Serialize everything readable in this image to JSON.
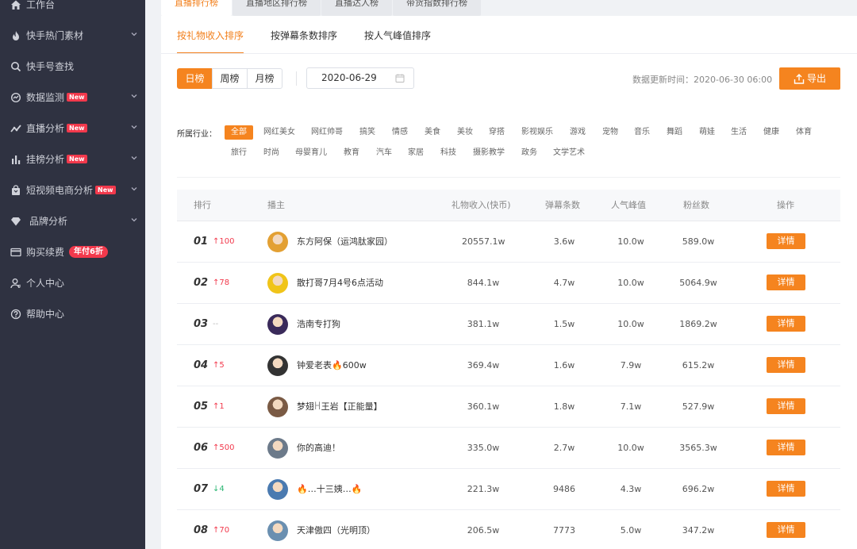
{
  "sidebar": {
    "items": [
      {
        "label": "工作台",
        "icon": "home-icon"
      },
      {
        "label": "快手热门素材",
        "icon": "fire-icon"
      },
      {
        "label": "快手号查找",
        "icon": "search-icon"
      },
      {
        "label": "数据监测",
        "icon": "monitor-icon",
        "badge": "New"
      },
      {
        "label": "直播分析",
        "icon": "trend-icon",
        "badge": "New"
      },
      {
        "label": "挂榜分析",
        "icon": "bars-icon",
        "badge": "New"
      },
      {
        "label": "短视频电商分析",
        "icon": "bag-icon",
        "badge": "New"
      },
      {
        "label": "品牌分析",
        "icon": "diamond-icon"
      },
      {
        "label": "购买续费",
        "icon": "card-icon",
        "promo": "年付6折"
      },
      {
        "label": "个人中心",
        "icon": "user-icon"
      },
      {
        "label": "帮助中心",
        "icon": "help-icon"
      }
    ]
  },
  "top_tabs": [
    "直播排行榜",
    "直播地区排行榜",
    "直播达人榜",
    "带货指数排行榜"
  ],
  "sub_tabs": [
    "按礼物收入排序",
    "按弹幕条数排序",
    "按人气峰值排序"
  ],
  "period": [
    "日榜",
    "周榜",
    "月榜"
  ],
  "date_value": "2020-06-29",
  "update_info": "数据更新时间：2020-06-30 06:00",
  "export_label": "导出",
  "industry_label": "所属行业：",
  "industries_row1": [
    "全部",
    "网红美女",
    "网红帅哥",
    "搞笑",
    "情感",
    "美食",
    "美妆",
    "穿搭",
    "影视娱乐",
    "游戏",
    "宠物",
    "音乐",
    "舞蹈",
    "萌娃",
    "生活",
    "健康",
    "体育"
  ],
  "industries_row2": [
    "旅行",
    "时尚",
    "母婴育儿",
    "教育",
    "汽车",
    "家居",
    "科技",
    "摄影教学",
    "政务",
    "文学艺术"
  ],
  "table": {
    "headers": [
      "排行",
      "播主",
      "礼物收入(快币)",
      "弹幕条数",
      "人气峰值",
      "粉丝数",
      "操作"
    ],
    "detail_label": "详情",
    "rows": [
      {
        "rank": "01",
        "change": "↑100",
        "dir": "up",
        "name": "东方阿保（运鸿肽家园）",
        "gift": "20557.1w",
        "danmu": "3.6w",
        "peak": "10.0w",
        "fans": "589.0w",
        "avatar_color": "#e3a033"
      },
      {
        "rank": "02",
        "change": "↑78",
        "dir": "up",
        "name": "散打哥7月4号6点活动",
        "gift": "844.1w",
        "danmu": "4.7w",
        "peak": "10.0w",
        "fans": "5064.9w",
        "avatar_color": "#f0c419"
      },
      {
        "rank": "03",
        "change": "--",
        "dir": "flat",
        "name": "浩南专打狗",
        "gift": "381.1w",
        "danmu": "1.5w",
        "peak": "10.0w",
        "fans": "1869.2w",
        "avatar_color": "#3a2a5a"
      },
      {
        "rank": "04",
        "change": "↑5",
        "dir": "up",
        "name": "钟爱老表🔥600w",
        "gift": "369.4w",
        "danmu": "1.6w",
        "peak": "7.9w",
        "fans": "615.2w",
        "avatar_color": "#333333"
      },
      {
        "rank": "05",
        "change": "↑1",
        "dir": "up",
        "name": "梦翅ꀿ王岩【正能量】",
        "gift": "360.1w",
        "danmu": "1.8w",
        "peak": "7.1w",
        "fans": "527.9w",
        "avatar_color": "#7a5a44"
      },
      {
        "rank": "06",
        "change": "↑500",
        "dir": "up",
        "name": "你的高迪！",
        "gift": "335.0w",
        "danmu": "2.7w",
        "peak": "10.0w",
        "fans": "3565.3w",
        "avatar_color": "#6c7a8a"
      },
      {
        "rank": "07",
        "change": "↓4",
        "dir": "down",
        "name": "🔥…十三姨…🔥",
        "gift": "221.3w",
        "danmu": "9486",
        "peak": "4.3w",
        "fans": "696.2w",
        "avatar_color": "#4a7ab0"
      },
      {
        "rank": "08",
        "change": "↑70",
        "dir": "up",
        "name": "天津傲四（光明顶）",
        "gift": "206.5w",
        "danmu": "7773",
        "peak": "5.0w",
        "fans": "347.2w",
        "avatar_color": "#6a8fb0"
      }
    ]
  },
  "colors": {
    "accent": "#f5841f",
    "sidebar_bg": "#2f3241",
    "badge": "#f2394c"
  }
}
